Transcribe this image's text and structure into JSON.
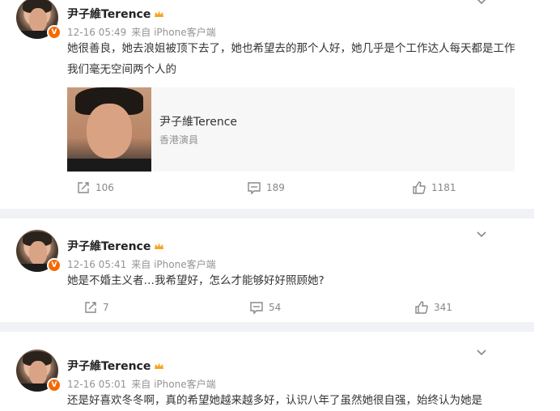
{
  "posts": [
    {
      "author": "尹子維Terence",
      "time": "12-16 05:49",
      "source": "来自 iPhone客户端",
      "text": "她很善良，她去浪姐被顶下去了，她也希望去的那个人好，她几乎是个工作达人每天都是工作 我们毫无空间两个人的",
      "card": {
        "title": "尹子維Terence",
        "subtitle": "香港演員"
      },
      "repost": "106",
      "comment": "189",
      "like": "1181"
    },
    {
      "author": "尹子維Terence",
      "time": "12-16 05:41",
      "source": "来自 iPhone客户端",
      "text": "她是不婚主义者…我希望好，怎么才能够好好照顾她?",
      "repost": "7",
      "comment": "54",
      "like": "341"
    },
    {
      "author": "尹子維Terence",
      "time": "12-16 05:01",
      "source": "来自 iPhone客户端",
      "text": "还是好喜欢冬冬啊，真的希望她越来越多好，认识八年了虽然她很自强，始终认为她是"
    }
  ],
  "icons": {
    "verified": "verified-badge-icon",
    "crown": "crown-icon",
    "chevron": "chevron-down-icon",
    "repost": "repost-icon",
    "comment": "comment-icon",
    "like": "like-icon"
  },
  "colors": {
    "verified": "#f56a00",
    "crown": "#f5a623",
    "divider": "#f1f2f5",
    "meta": "#939393"
  }
}
